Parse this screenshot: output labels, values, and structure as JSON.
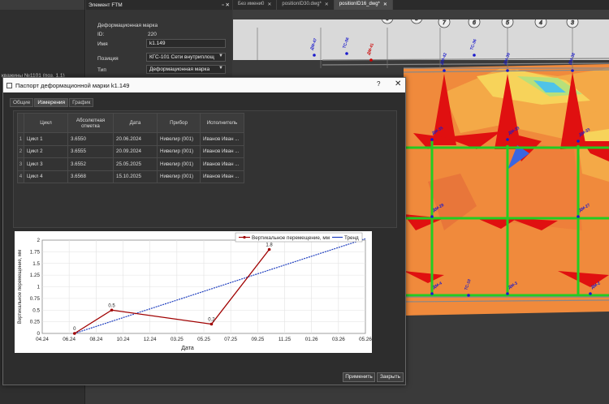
{
  "left_panel": {
    "row_title": "кважины №1101 (поз. 1.1)"
  },
  "element_panel": {
    "title": "Элемент FTM",
    "section": "Деформационная марка",
    "fields": [
      {
        "label": "ID:",
        "value": "220"
      },
      {
        "label": "Имя",
        "value": "k1.149"
      },
      {
        "label": "Позиция",
        "value": "КГС-101 Сети внутриплощ"
      },
      {
        "label": "Тип",
        "value": "Деформационная марка"
      }
    ]
  },
  "doc_tabs": [
    {
      "label": "Без имени0"
    },
    {
      "label": "positionID30.dwg*"
    },
    {
      "label": "positionID16_dwg*"
    }
  ],
  "drawing": {
    "grid_markers": [
      "8",
      "7",
      "6",
      "5",
      "4",
      "3"
    ],
    "mark_labels": [
      "ДМ-47",
      "ТС-56",
      "ДМ-41",
      "ДМ-42",
      "ТС-36",
      "ДМ-39",
      "ДМ-38",
      "ДМ-35",
      "ДМ-33",
      "ДМ-33",
      "ДМ-28",
      "ДМ-27",
      "ДМ-4",
      "ТС-10",
      "ДМ-3",
      "ДМ-2"
    ]
  },
  "dialog": {
    "title": "Паспорт деформационной марки k1.149",
    "help": "?",
    "close": "✕",
    "tabs": [
      {
        "label": "Общие",
        "active": false
      },
      {
        "label": "Измерения",
        "active": true
      },
      {
        "label": "График",
        "active": false
      }
    ],
    "table": {
      "headers": [
        "Цикл",
        "Абсолютная отметка",
        "Дата",
        "Прибор",
        "Исполнитель"
      ],
      "rows": [
        {
          "idx": "1",
          "cycle": "Цикл 1",
          "elev": "3.6550",
          "date": "20.06.2024",
          "device": "Нивелир (001)",
          "person": "Иванов Иван ..."
        },
        {
          "idx": "2",
          "cycle": "Цикл 2",
          "elev": "3.6555",
          "date": "20.09.2024",
          "device": "Нивелир (001)",
          "person": "Иванов Иван ..."
        },
        {
          "idx": "3",
          "cycle": "Цикл 3",
          "elev": "3.6552",
          "date": "25.05.2025",
          "device": "Нивелир (001)",
          "person": "Иванов Иван ..."
        },
        {
          "idx": "4",
          "cycle": "Цикл 4",
          "elev": "3.6568",
          "date": "15.10.2025",
          "device": "Нивелир (001)",
          "person": "Иванов Иван ..."
        }
      ]
    },
    "buttons": {
      "apply": "Применить",
      "close": "Закрыть"
    }
  },
  "chart_data": {
    "type": "line",
    "xlabel": "Дата",
    "ylabel": "Вертикальное перемещение, мм",
    "x_ticks": [
      "04.24",
      "06.24",
      "08.24",
      "10.24",
      "12.24",
      "03.25",
      "05.25",
      "07.25",
      "09.25",
      "11.25",
      "01.26",
      "03.26",
      "05.26"
    ],
    "ylim": [
      0,
      2
    ],
    "y_ticks": [
      "0",
      "0.25",
      "0.5",
      "0.75",
      "1",
      "1.25",
      "1.5",
      "1.75",
      "2"
    ],
    "grid": true,
    "legend_position": "top-right",
    "series": [
      {
        "name": "Вертикальное перемещение, мм",
        "color": "#a00000",
        "x": [
          "20.06.2024",
          "20.09.2024",
          "25.05.2025",
          "15.10.2025"
        ],
        "y": [
          0,
          0.5,
          0.2,
          1.8
        ],
        "labels": [
          "0",
          "0.5",
          "0.2",
          "1.8"
        ]
      },
      {
        "name": "Тренд",
        "color": "#1f3fbf",
        "x": [
          "20.06.2024",
          "10.06.2026"
        ],
        "y": [
          0,
          2.03
        ]
      }
    ]
  }
}
